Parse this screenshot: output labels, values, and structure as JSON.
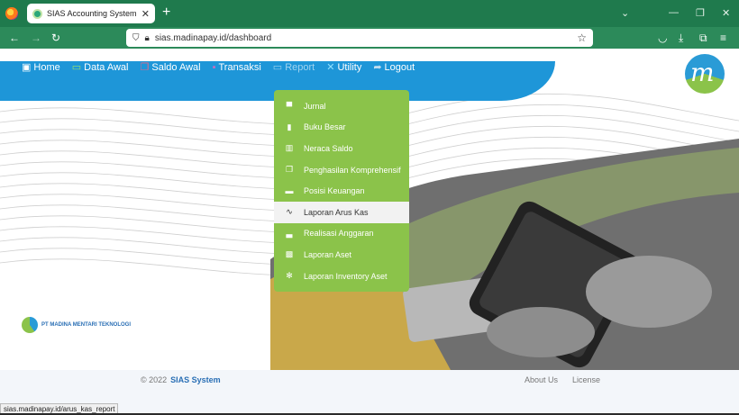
{
  "browser": {
    "tab_title": "SIAS Accounting System",
    "close_glyph": "✕",
    "new_tab_glyph": "+",
    "url": "sias.madinapay.id/dashboard",
    "status_url": "sias.madinapay.id/arus_kas_report"
  },
  "nav": {
    "items": [
      {
        "label": "Home",
        "icon": "home-icon"
      },
      {
        "label": "Data Awal",
        "icon": "monitor-icon"
      },
      {
        "label": "Saldo Awal",
        "icon": "copy-icon"
      },
      {
        "label": "Transaksi",
        "icon": "cart-icon"
      },
      {
        "label": "Report",
        "icon": "monitor-icon"
      },
      {
        "label": "Utility",
        "icon": "tools-icon"
      },
      {
        "label": "Logout",
        "icon": "logout-icon"
      }
    ]
  },
  "report_menu": {
    "items": [
      {
        "label": "Jurnal",
        "icon": "briefcase-icon"
      },
      {
        "label": "Buku Besar",
        "icon": "book-icon"
      },
      {
        "label": "Neraca Saldo",
        "icon": "books-icon"
      },
      {
        "label": "Penghasilan Komprehensif",
        "icon": "copy-icon"
      },
      {
        "label": "Posisi Keuangan",
        "icon": "card-icon"
      },
      {
        "label": "Laporan Arus Kas",
        "icon": "pulse-icon"
      },
      {
        "label": "Realisasi Anggaran",
        "icon": "bar-chart-icon"
      },
      {
        "label": "Laporan Aset",
        "icon": "toolbox-icon"
      },
      {
        "label": "Laporan Inventory Aset",
        "icon": "gear-icon"
      }
    ],
    "highlighted_index": 5
  },
  "company_name": "PT MADINA MENTARI TEKNOLOGI",
  "footer": {
    "copyright": "© 2022",
    "system_name": "SIAS System",
    "about": "About Us",
    "license": "License"
  },
  "colors": {
    "nav_blue": "#1e96d8",
    "menu_green": "#8bc34a",
    "browser_green": "#1f7a4d"
  }
}
